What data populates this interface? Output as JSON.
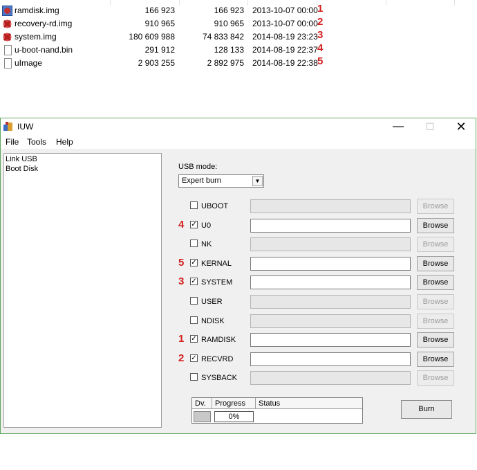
{
  "files": [
    {
      "name": "ramdisk.img",
      "size": "166 923",
      "packed": "166 923",
      "date": "2013-10-07 00:00",
      "mark": "1",
      "icon": "image-file-icon"
    },
    {
      "name": "recovery-rd.img",
      "size": "910 965",
      "packed": "910 965",
      "date": "2013-10-07 00:00",
      "mark": "2",
      "icon": "burst-file-icon"
    },
    {
      "name": "system.img",
      "size": "180 609 988",
      "packed": "74 833 842",
      "date": "2014-08-19 23:23",
      "mark": "3",
      "icon": "burst-file-icon"
    },
    {
      "name": "u-boot-nand.bin",
      "size": "291 912",
      "packed": "128 133",
      "date": "2014-08-19 22:37",
      "mark": "4",
      "icon": "document-icon"
    },
    {
      "name": "uImage",
      "size": "2 903 255",
      "packed": "2 892 975",
      "date": "2014-08-19 22:38",
      "mark": "5",
      "icon": "document-icon"
    }
  ],
  "window": {
    "title": "IUW",
    "controls": {
      "minimize": "—",
      "maximize": "☐",
      "close": "✕"
    }
  },
  "menu": {
    "file": "File",
    "tools": "Tools",
    "help": "Help"
  },
  "nav": {
    "items": [
      "Link USB",
      "Boot Disk"
    ]
  },
  "usb_mode": {
    "label": "USB mode:",
    "value": "Expert burn",
    "arrow": "▼"
  },
  "partitions": [
    {
      "name": "UBOOT",
      "checked": false,
      "mark": "",
      "enabled": false,
      "browse": "Browse"
    },
    {
      "name": "U0",
      "checked": true,
      "mark": "4",
      "enabled": true,
      "browse": "Browse"
    },
    {
      "name": "NK",
      "checked": false,
      "mark": "",
      "enabled": false,
      "browse": "Browse"
    },
    {
      "name": "KERNAL",
      "checked": true,
      "mark": "5",
      "enabled": true,
      "browse": "Browse"
    },
    {
      "name": "SYSTEM",
      "checked": true,
      "mark": "3",
      "enabled": true,
      "browse": "Browse"
    },
    {
      "name": "USER",
      "checked": false,
      "mark": "",
      "enabled": false,
      "browse": "Browse"
    },
    {
      "name": "NDISK",
      "checked": false,
      "mark": "",
      "enabled": false,
      "browse": "Browse"
    },
    {
      "name": "RAMDISK",
      "checked": true,
      "mark": "1",
      "enabled": true,
      "browse": "Browse"
    },
    {
      "name": "RECVRD",
      "checked": true,
      "mark": "2",
      "enabled": true,
      "browse": "Browse"
    },
    {
      "name": "SYSBACK",
      "checked": false,
      "mark": "",
      "enabled": false,
      "browse": "Browse"
    }
  ],
  "progress_table": {
    "headers": {
      "dv": "Dv.",
      "progress": "Progress",
      "status": "Status"
    },
    "row": {
      "progress": "0%",
      "status": ""
    }
  },
  "burn_button": "Burn",
  "colors": {
    "annotation": "#d21f1f",
    "window_border": "#5fa55f",
    "window_bg": "#f0f0f0"
  }
}
